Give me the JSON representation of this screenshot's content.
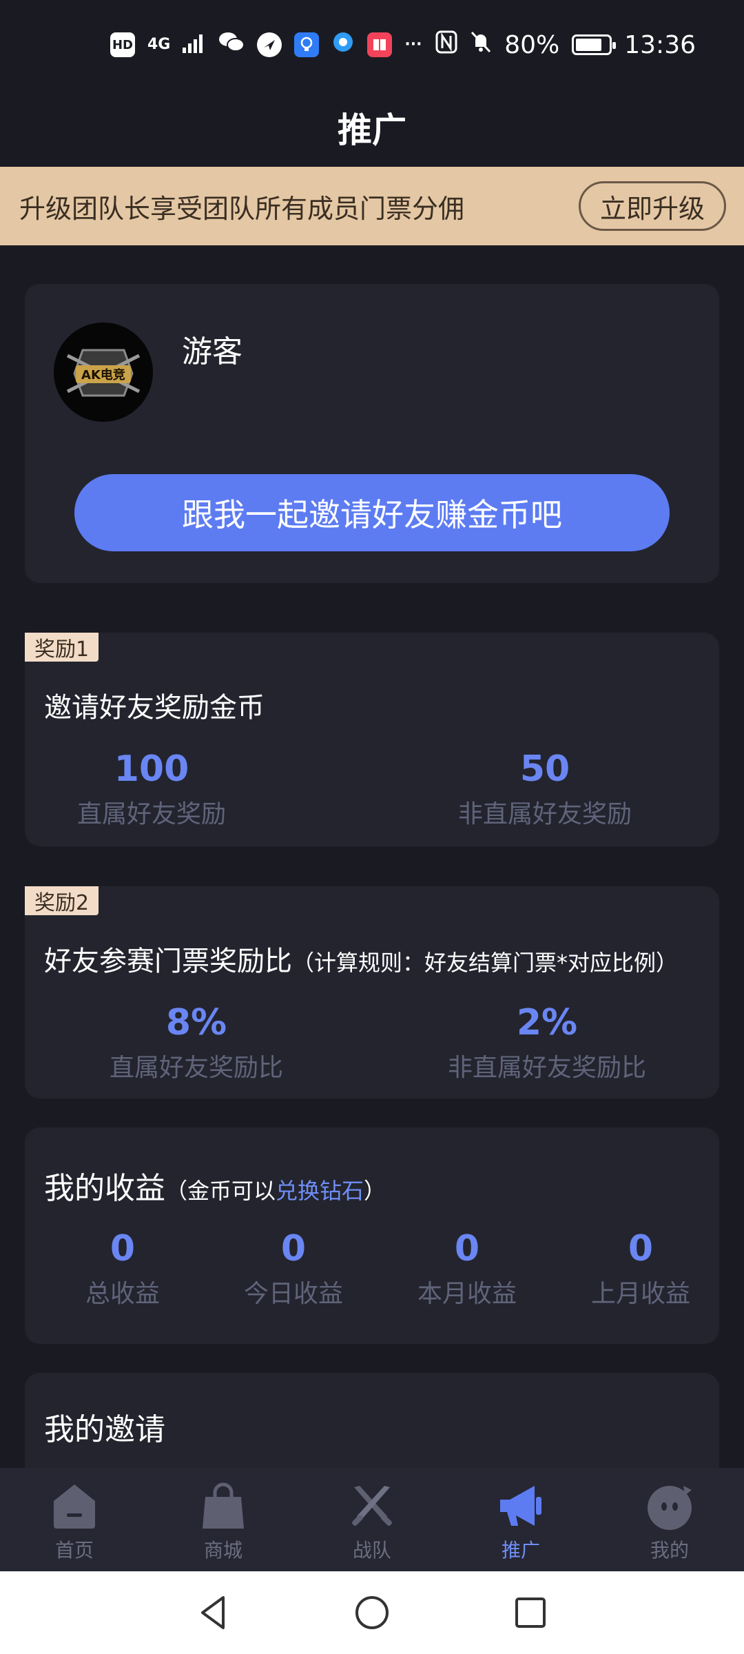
{
  "status_bar": {
    "network": "4G",
    "hd": "HD",
    "more": "···",
    "battery": "80%",
    "battery_level": 0.8,
    "time": "13:36"
  },
  "header": {
    "title": "推广"
  },
  "banner": {
    "text": "升级团队长享受团队所有成员门票分佣",
    "button": "立即升级"
  },
  "profile": {
    "username": "游客",
    "avatar_logo": "AK电竞",
    "invite_button": "跟我一起邀请好友赚金币吧"
  },
  "reward1": {
    "tag": "奖励1",
    "title": "邀请好友奖励金币",
    "direct_value": "100",
    "direct_label": "直属好友奖励",
    "indirect_value": "50",
    "indirect_label": "非直属好友奖励"
  },
  "reward2": {
    "tag": "奖励2",
    "title": "好友参赛门票奖励比",
    "note": "（计算规则：好友结算门票*对应比例）",
    "direct_value": "8%",
    "direct_label": "直属好友奖励比",
    "indirect_value": "2%",
    "indirect_label": "非直属好友奖励比"
  },
  "earnings": {
    "title": "我的收益",
    "note_prefix": "（金币可以",
    "note_link": "兑换钻石",
    "note_suffix": "）",
    "items": [
      {
        "value": "0",
        "label": "总收益"
      },
      {
        "value": "0",
        "label": "今日收益"
      },
      {
        "value": "0",
        "label": "本月收益"
      },
      {
        "value": "0",
        "label": "上月收益"
      }
    ]
  },
  "invites": {
    "title": "我的邀请"
  },
  "bottom_nav": {
    "items": [
      {
        "label": "首页",
        "icon": "home-icon"
      },
      {
        "label": "商城",
        "icon": "shopping-bag-icon"
      },
      {
        "label": "战队",
        "icon": "crossed-swords-icon"
      },
      {
        "label": "推广",
        "icon": "megaphone-icon",
        "active": true
      },
      {
        "label": "我的",
        "icon": "profile-face-icon"
      }
    ]
  },
  "colors": {
    "background": "#1a1b22",
    "card": "#23242e",
    "accent": "#5d7cf2",
    "banner": "#e4c7a4"
  }
}
